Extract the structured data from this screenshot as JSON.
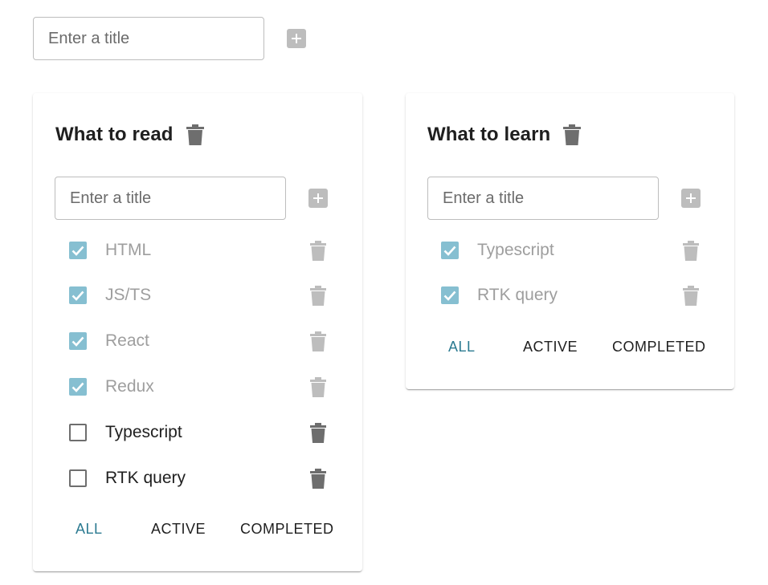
{
  "new_list": {
    "placeholder": "Enter a title",
    "add_icon": "plus-square-icon"
  },
  "lists": [
    {
      "title": "What to read",
      "delete_icon": "trash-icon",
      "new_task_placeholder": "Enter a title",
      "tasks": [
        {
          "label": "HTML",
          "done": true
        },
        {
          "label": "JS/TS",
          "done": true
        },
        {
          "label": "React",
          "done": true
        },
        {
          "label": "Redux",
          "done": true
        },
        {
          "label": "Typescript",
          "done": false
        },
        {
          "label": "RTK query",
          "done": false
        }
      ],
      "filters": {
        "all": "ALL",
        "active": "ACTIVE",
        "completed": "COMPLETED",
        "selected": "all"
      }
    },
    {
      "title": "What to learn",
      "delete_icon": "trash-icon",
      "new_task_placeholder": "Enter a title",
      "tasks": [
        {
          "label": "Typescript",
          "done": true
        },
        {
          "label": "RTK query",
          "done": true
        }
      ],
      "filters": {
        "all": "ALL",
        "active": "ACTIVE",
        "completed": "COMPLETED",
        "selected": "all"
      }
    }
  ],
  "colors": {
    "checkbox_checked": "#86bfd1",
    "filter_selected": "#2b7a91",
    "icon_active": "#6e6e6e",
    "icon_disabled": "#bdbdbd",
    "done_text": "#9e9e9e"
  }
}
